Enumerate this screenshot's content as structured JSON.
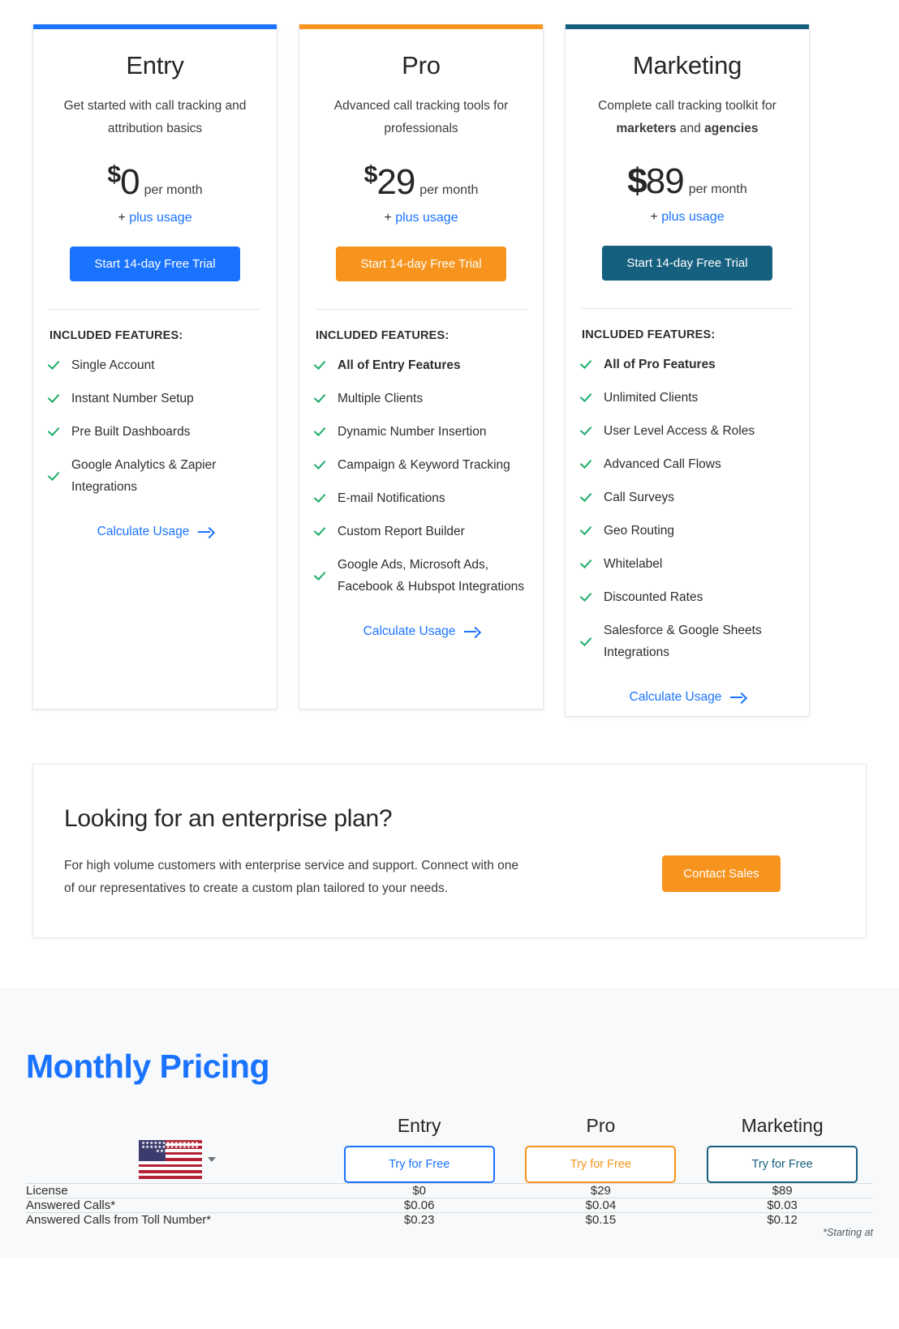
{
  "plans": [
    {
      "name": "Entry",
      "accent": "#1a73ff",
      "description": "Get started with call tracking and attribution basics",
      "currency": "$",
      "amount": "0",
      "per_month": "per month",
      "plus_prefix": "+",
      "plus_usage": "plus usage",
      "cta_label": "Start 14-day Free Trial",
      "features_title": "INCLUDED FEATURES:",
      "features": [
        {
          "text": "Single Account",
          "bold": false
        },
        {
          "text": "Instant Number Setup",
          "bold": false
        },
        {
          "text": "Pre Built Dashboards",
          "bold": false
        },
        {
          "text": "Google Analytics & Zapier Integrations",
          "bold": false
        }
      ],
      "calculate_label": "Calculate Usage"
    },
    {
      "name": "Pro",
      "accent": "#f7941e",
      "description": "Advanced call tracking tools for professionals",
      "currency": "$",
      "amount": "29",
      "per_month": "per month",
      "plus_prefix": "+",
      "plus_usage": "plus usage",
      "cta_label": "Start 14-day Free Trial",
      "features_title": "INCLUDED FEATURES:",
      "features": [
        {
          "text": "All of Entry Features",
          "bold": true
        },
        {
          "text": "Multiple Clients",
          "bold": false
        },
        {
          "text": "Dynamic Number Insertion",
          "bold": false
        },
        {
          "text": "Campaign & Keyword Tracking",
          "bold": false
        },
        {
          "text": "E-mail Notifications",
          "bold": false
        },
        {
          "text": "Custom Report Builder",
          "bold": false
        },
        {
          "text": "Google Ads, Microsoft Ads, Facebook & Hubspot Integrations",
          "bold": false
        }
      ],
      "calculate_label": "Calculate Usage"
    },
    {
      "name": "Marketing",
      "accent": "#16607f",
      "description_prefix": "Complete call tracking toolkit for ",
      "description_bold_1": "marketers",
      "description_mid": " and ",
      "description_bold_2": "agencies",
      "description": "Complete call tracking toolkit for marketers and agencies",
      "currency": "$",
      "amount": "89",
      "per_month": "per month",
      "plus_prefix": "+",
      "plus_usage": "plus usage",
      "cta_label": "Start 14-day Free Trial",
      "features_title": "INCLUDED FEATURES:",
      "features": [
        {
          "text": "All of Pro Features",
          "bold": true
        },
        {
          "text": "Unlimited Clients",
          "bold": false
        },
        {
          "text": "User Level Access & Roles",
          "bold": false
        },
        {
          "text": "Advanced Call Flows",
          "bold": false
        },
        {
          "text": "Call Surveys",
          "bold": false
        },
        {
          "text": "Geo Routing",
          "bold": false
        },
        {
          "text": "Whitelabel",
          "bold": false
        },
        {
          "text": "Discounted Rates",
          "bold": false
        },
        {
          "text": "Salesforce & Google Sheets Integrations",
          "bold": false
        }
      ],
      "calculate_label": "Calculate Usage"
    }
  ],
  "enterprise": {
    "title": "Looking for an enterprise plan?",
    "body": "For high volume customers with enterprise service and support. Connect with one of our representatives to create a custom plan tailored to your needs.",
    "button_label": "Contact Sales",
    "button_color": "#f7941e"
  },
  "monthly_pricing": {
    "title": "Monthly Pricing",
    "title_color": "#1a73ff",
    "country_icon": "us-flag-icon",
    "columns": [
      {
        "name": "Entry",
        "button_label": "Try for Free",
        "color": "#1a73ff"
      },
      {
        "name": "Pro",
        "button_label": "Try for Free",
        "color": "#f7941e"
      },
      {
        "name": "Marketing",
        "button_label": "Try for Free",
        "color": "#16607f"
      }
    ],
    "rows": [
      {
        "label": "License",
        "values": [
          "$0",
          "$29",
          "$89"
        ]
      },
      {
        "label": "Answered Calls*",
        "values": [
          "$0.06",
          "$0.04",
          "$0.03"
        ]
      },
      {
        "label": "Answered Calls from Toll Number*",
        "values": [
          "$0.23",
          "$0.15",
          "$0.12"
        ]
      }
    ],
    "footnote": "*Starting at"
  }
}
